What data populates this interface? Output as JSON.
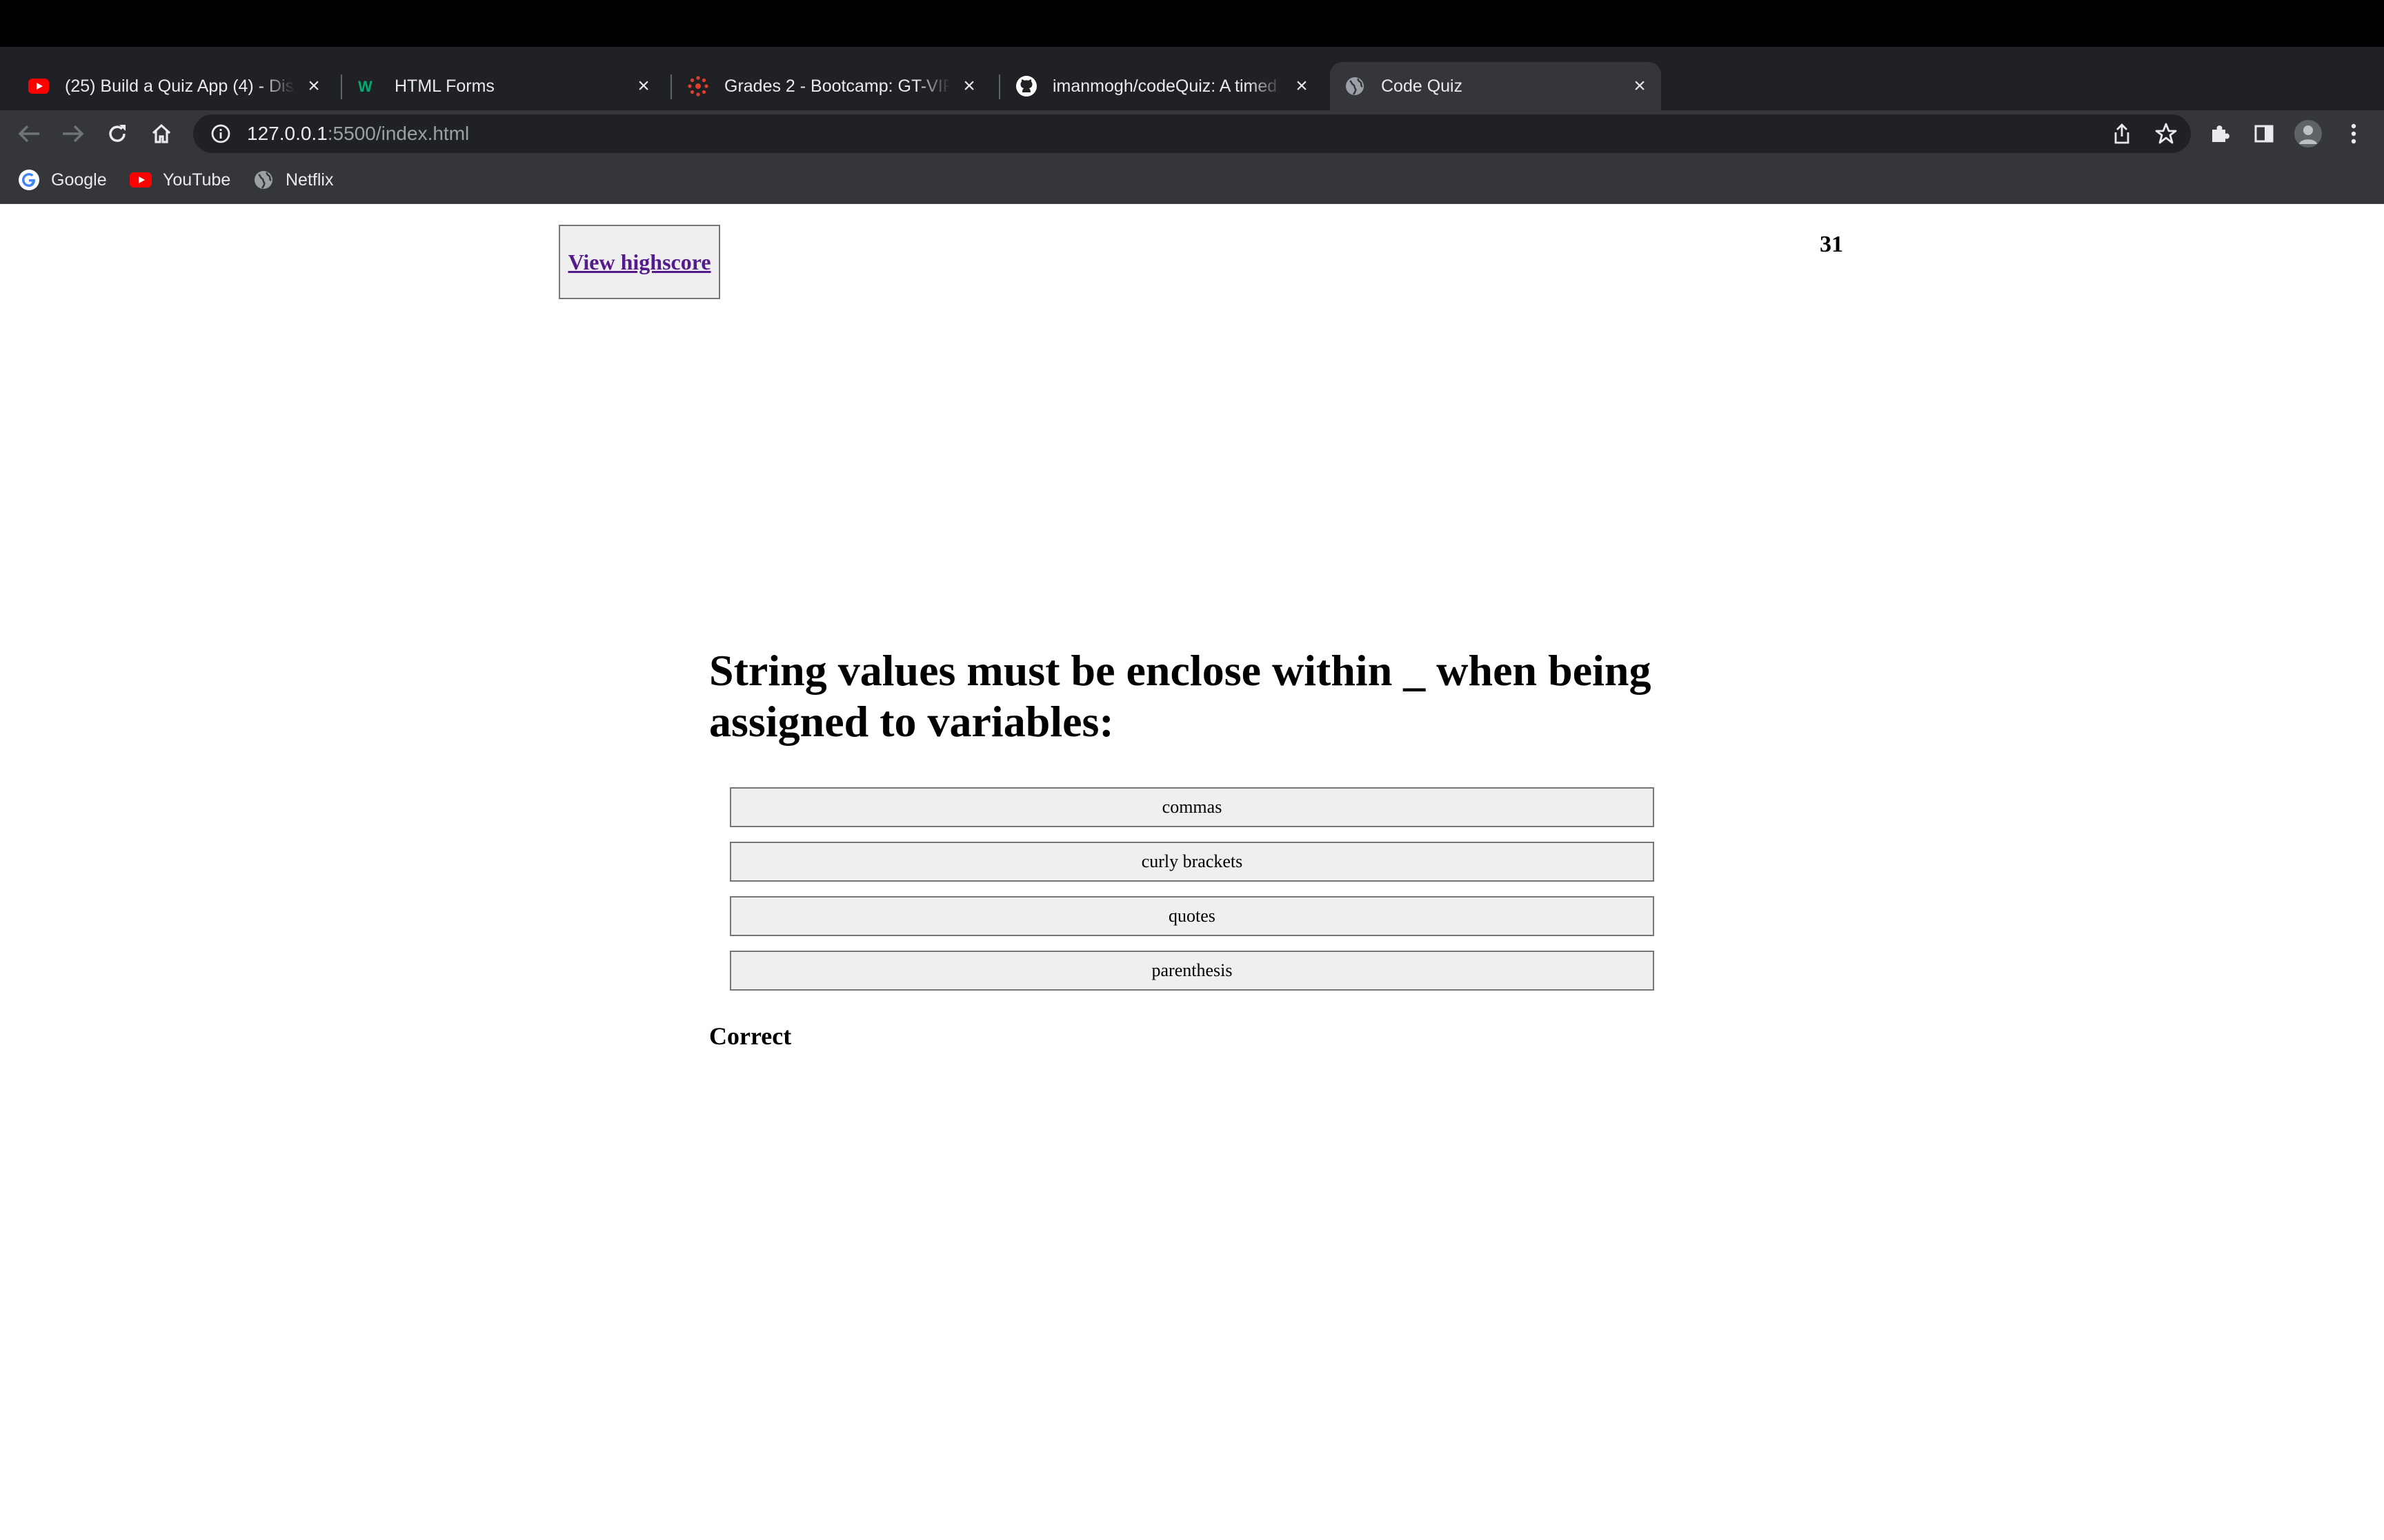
{
  "browser": {
    "tabs": [
      {
        "title": "(25) Build a Quiz App (4) - Disp",
        "icon": "youtube-icon",
        "active": false
      },
      {
        "title": "HTML Forms",
        "icon": "w3schools-icon",
        "active": false
      },
      {
        "title": "Grades 2 - Bootcamp: GT-VIRT",
        "icon": "canvas-icon",
        "active": false
      },
      {
        "title": "imanmogh/codeQuiz: A timed c",
        "icon": "github-icon",
        "active": false
      },
      {
        "title": "Code Quiz",
        "icon": "globe-icon",
        "active": true
      }
    ],
    "address": {
      "host": "127.0.0.1",
      "path": ":5500/index.html"
    },
    "bookmarks": [
      {
        "label": "Google",
        "icon": "google-icon"
      },
      {
        "label": "YouTube",
        "icon": "youtube-icon"
      },
      {
        "label": "Netflix",
        "icon": "globe-icon"
      }
    ]
  },
  "quiz": {
    "highscore_label": "View highscore",
    "timer": "31",
    "question": "String values must be enclose within _ when being assigned to variables:",
    "answers": [
      "commas",
      "curly brackets",
      "quotes",
      "parenthesis"
    ],
    "feedback": "Correct"
  },
  "colors": {
    "chrome_dark": "#202124",
    "chrome_toolbar": "#35363a",
    "link_visited": "#551a8b",
    "button_bg": "#efefef"
  }
}
